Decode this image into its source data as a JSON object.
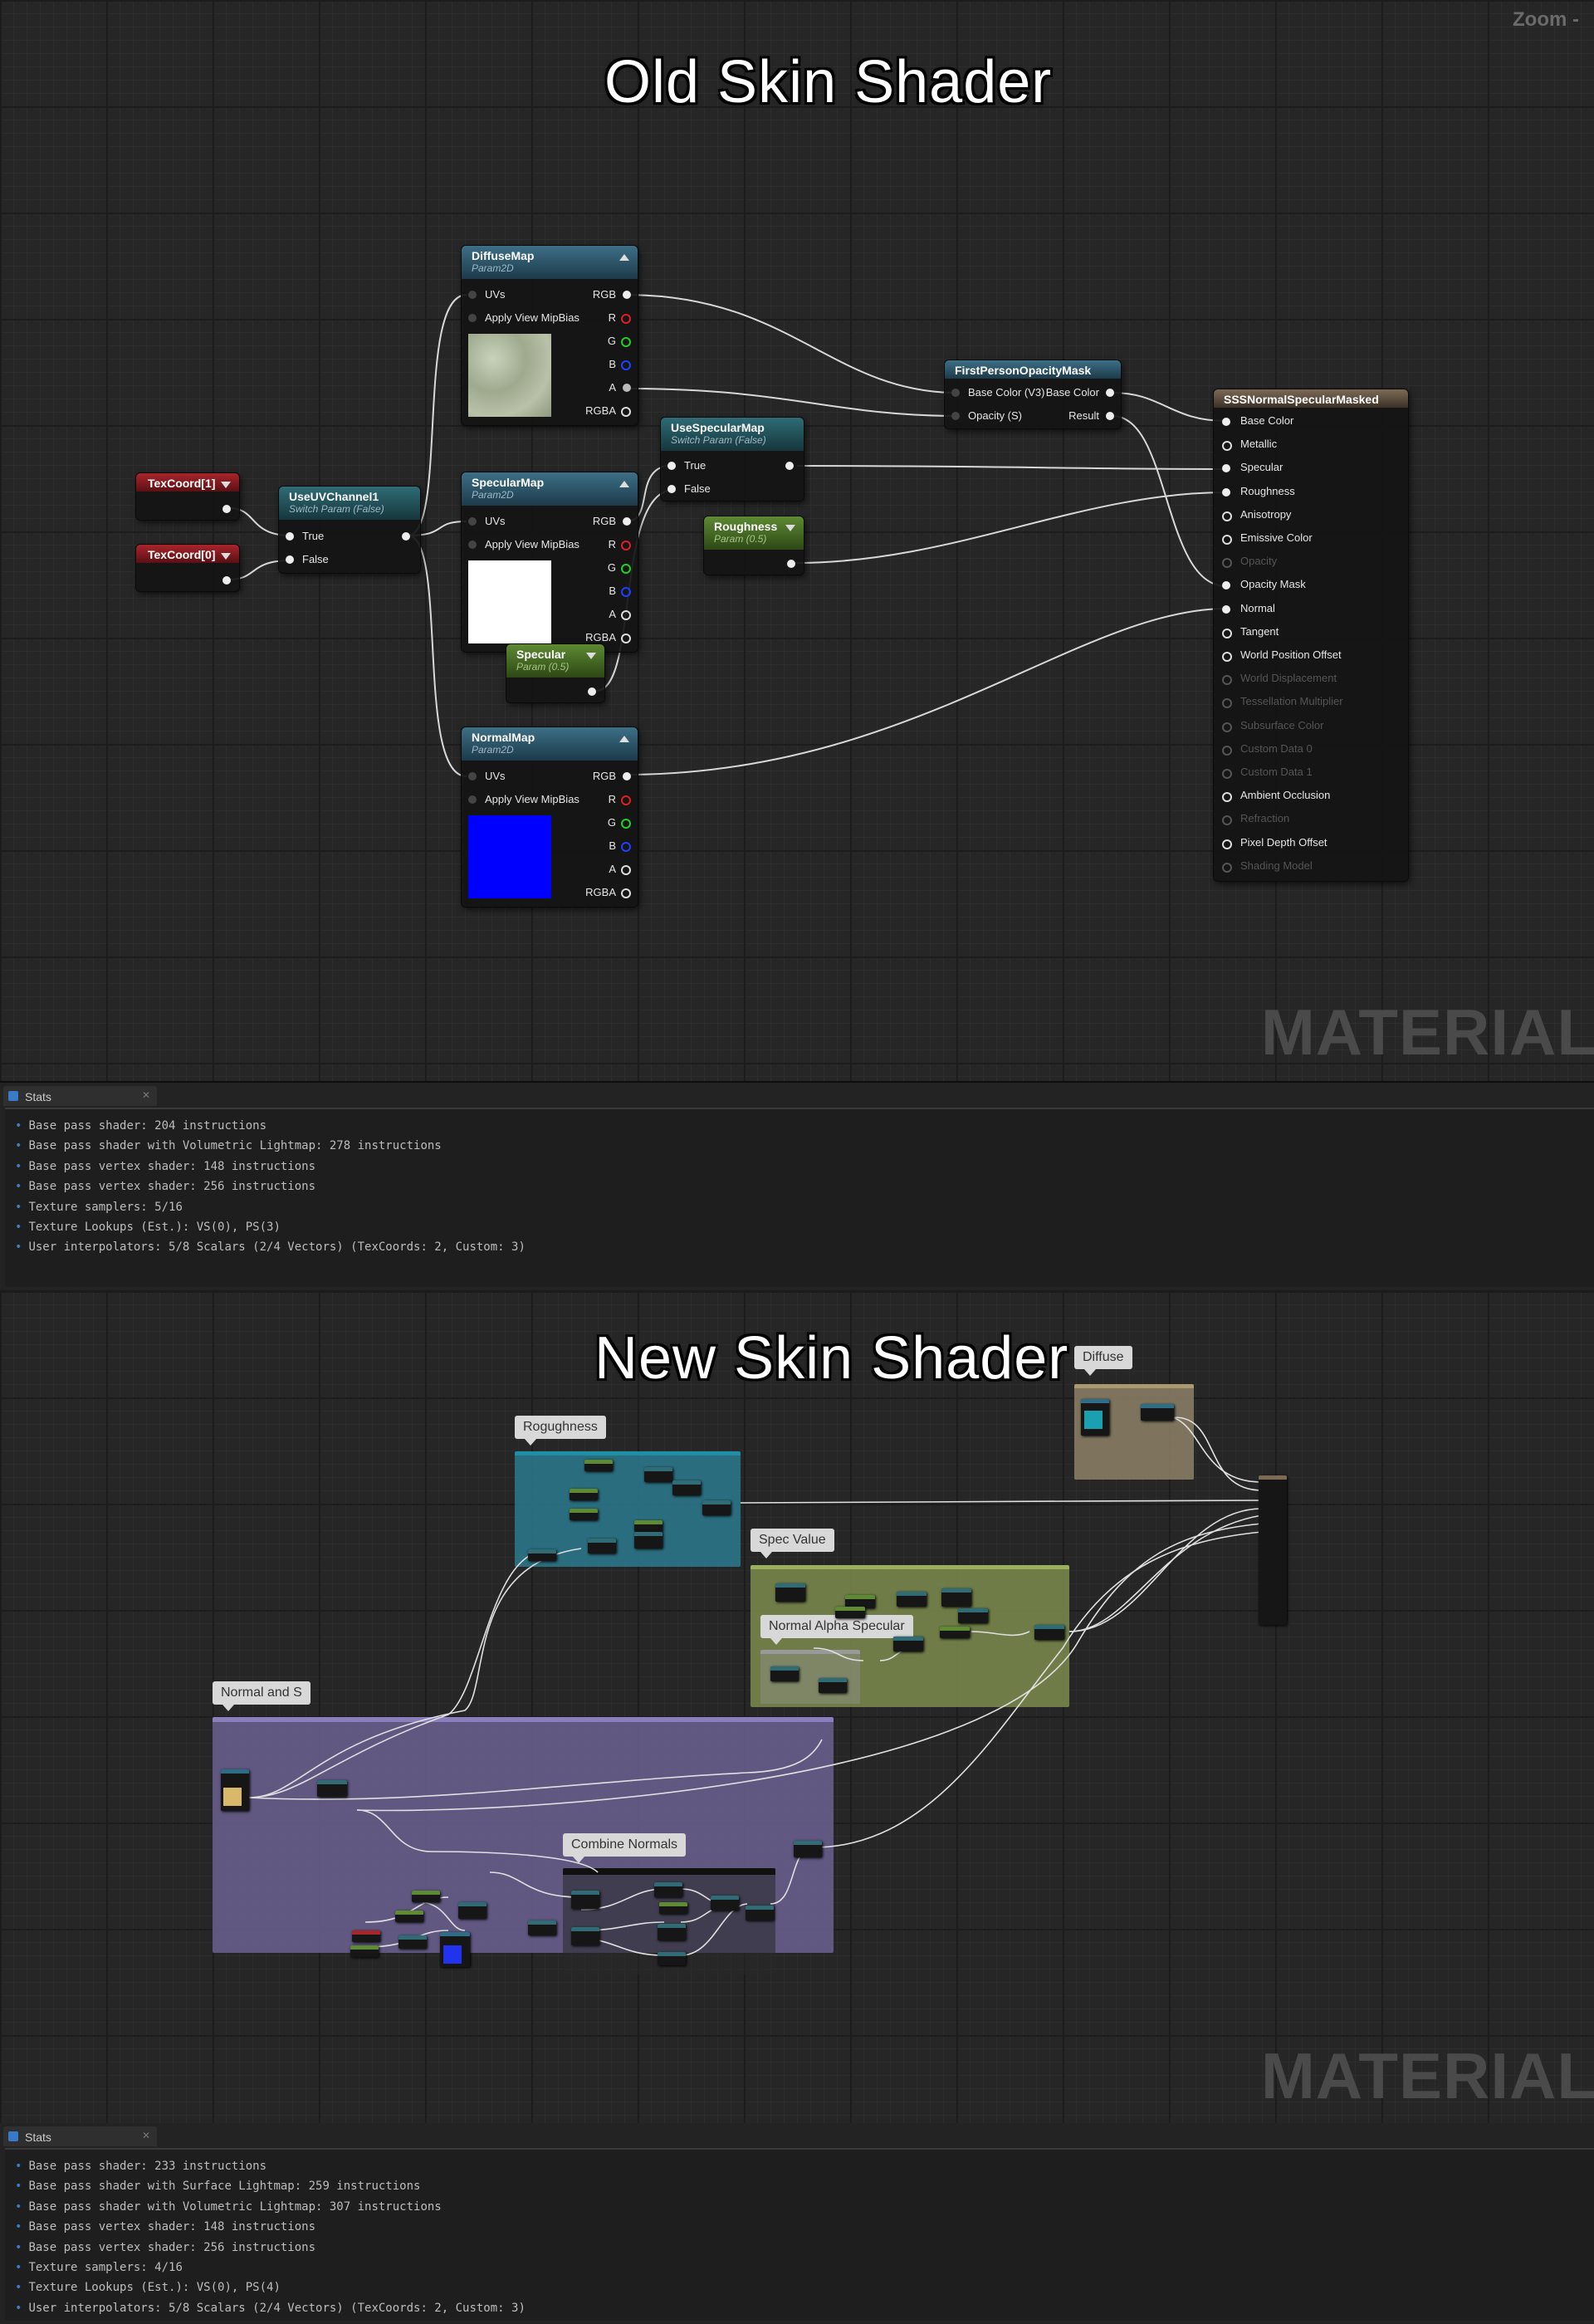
{
  "old": {
    "title": "Old Skin Shader",
    "zoom_label": "Zoom -",
    "watermark": "MATERIAL",
    "nodes": {
      "texcoord1": {
        "title": "TexCoord[1]"
      },
      "texcoord0": {
        "title": "TexCoord[0]"
      },
      "useuv": {
        "title": "UseUVChannel1",
        "subtitle": "Switch Param (False)",
        "pins": [
          "True",
          "False"
        ]
      },
      "diffuse": {
        "title": "DiffuseMap",
        "subtitle": "Param2D",
        "inputs": [
          "UVs",
          "Apply View MipBias"
        ],
        "outputs": [
          "RGB",
          "R",
          "G",
          "B",
          "A",
          "RGBA"
        ]
      },
      "specmap": {
        "title": "SpecularMap",
        "subtitle": "Param2D",
        "inputs": [
          "UVs",
          "Apply View MipBias"
        ],
        "outputs": [
          "RGB",
          "R",
          "G",
          "B",
          "A",
          "RGBA"
        ]
      },
      "normal": {
        "title": "NormalMap",
        "subtitle": "Param2D",
        "inputs": [
          "UVs",
          "Apply View MipBias"
        ],
        "outputs": [
          "RGB",
          "R",
          "G",
          "B",
          "A",
          "RGBA"
        ]
      },
      "usespec": {
        "title": "UseSpecularMap",
        "subtitle": "Switch Param (False)",
        "pins": [
          "True",
          "False"
        ]
      },
      "rough": {
        "title": "Roughness",
        "subtitle": "Param (0.5)"
      },
      "specparam": {
        "title": "Specular",
        "subtitle": "Param (0.5)"
      },
      "fpom": {
        "title": "FirstPersonOpacityMask",
        "inputs": [
          "Base Color (V3)",
          "Opacity (S)"
        ],
        "outputs": [
          "Base Color",
          "Result"
        ]
      },
      "sss": {
        "title": "SSSNormalSpecularMasked",
        "pins": [
          {
            "label": "Base Color",
            "active": true,
            "filled": true
          },
          {
            "label": "Metallic",
            "active": true,
            "filled": false
          },
          {
            "label": "Specular",
            "active": true,
            "filled": true
          },
          {
            "label": "Roughness",
            "active": true,
            "filled": true
          },
          {
            "label": "Anisotropy",
            "active": true,
            "filled": false
          },
          {
            "label": "Emissive Color",
            "active": true,
            "filled": false
          },
          {
            "label": "Opacity",
            "active": false,
            "filled": false
          },
          {
            "label": "Opacity Mask",
            "active": true,
            "filled": true
          },
          {
            "label": "Normal",
            "active": true,
            "filled": true
          },
          {
            "label": "Tangent",
            "active": true,
            "filled": false
          },
          {
            "label": "World Position Offset",
            "active": true,
            "filled": false
          },
          {
            "label": "World Displacement",
            "active": false,
            "filled": false
          },
          {
            "label": "Tessellation Multiplier",
            "active": false,
            "filled": false
          },
          {
            "label": "Subsurface Color",
            "active": false,
            "filled": false
          },
          {
            "label": "Custom Data 0",
            "active": false,
            "filled": false
          },
          {
            "label": "Custom Data 1",
            "active": false,
            "filled": false
          },
          {
            "label": "Ambient Occlusion",
            "active": true,
            "filled": false
          },
          {
            "label": "Refraction",
            "active": false,
            "filled": false
          },
          {
            "label": "Pixel Depth Offset",
            "active": true,
            "filled": false
          },
          {
            "label": "Shading Model",
            "active": false,
            "filled": false
          }
        ]
      }
    },
    "stats": {
      "tab_label": "Stats",
      "lines": [
        "Base pass shader: 204 instructions",
        "Base pass shader with Volumetric Lightmap: 278 instructions",
        "Base pass vertex shader: 148 instructions",
        "Base pass vertex shader: 256 instructions",
        "Texture samplers: 5/16",
        "Texture Lookups (Est.): VS(0), PS(3)",
        "User interpolators: 5/8 Scalars (2/4 Vectors) (TexCoords: 2, Custom: 3)"
      ]
    }
  },
  "new": {
    "title": "New Skin Shader",
    "watermark": "MATERIAL",
    "comments": {
      "diffuse": "Diffuse",
      "roughness": "Rogughness",
      "spec_value": "Spec Value",
      "normal_alpha_specular": "Normal Alpha Specular",
      "normal_and_s": "Normal and S",
      "combine_normals": "Combine Normals"
    },
    "colors": {
      "diffuse": "#8e8269",
      "roughness": "#2c7a8e",
      "spec": "#7d8c4e",
      "normal": "#6b6192"
    },
    "stats": {
      "tab_label": "Stats",
      "lines": [
        "Base pass shader: 233 instructions",
        "Base pass shader with Surface Lightmap: 259 instructions",
        "Base pass shader with Volumetric Lightmap: 307 instructions",
        "Base pass vertex shader: 148 instructions",
        "Base pass vertex shader: 256 instructions",
        "Texture samplers: 4/16",
        "Texture Lookups (Est.): VS(0), PS(4)",
        "User interpolators: 5/8 Scalars (2/4 Vectors) (TexCoords: 2, Custom: 3)"
      ]
    }
  }
}
